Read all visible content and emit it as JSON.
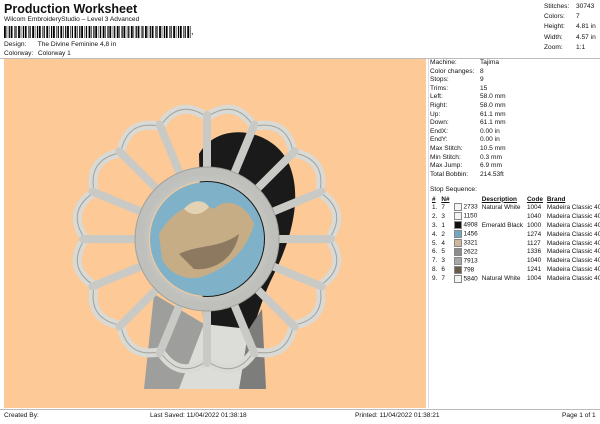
{
  "header": {
    "title": "Production Worksheet",
    "subtitle": "Wilcom EmbroideryStudio – Level 3 Advanced",
    "barcode_mark": ","
  },
  "meta": {
    "design_label": "Design:",
    "design_value": "The Divine Feminine 4,8 in",
    "colorway_label": "Colorway:",
    "colorway_value": "Colorway 1"
  },
  "stats": [
    {
      "label": "Stitches:",
      "value": "30743"
    },
    {
      "label": "Colors:",
      "value": "7"
    },
    {
      "label": "Height:",
      "value": "4.81 in"
    },
    {
      "label": "Width:",
      "value": "4.57 in"
    },
    {
      "label": "Zoom:",
      "value": "1:1"
    }
  ],
  "params": [
    {
      "label": "Machine:",
      "value": "Tajima"
    },
    {
      "label": "Color changes:",
      "value": "8"
    },
    {
      "label": "Stops:",
      "value": "9"
    },
    {
      "label": "Trims:",
      "value": "15"
    },
    {
      "label": "Left:",
      "value": "58.0 mm"
    },
    {
      "label": "Right:",
      "value": "58.0 mm"
    },
    {
      "label": "Up:",
      "value": "61.1 mm"
    },
    {
      "label": "Down:",
      "value": "61.1 mm"
    },
    {
      "label": "EndX:",
      "value": "0.00 in"
    },
    {
      "label": "EndY:",
      "value": "0.00 in"
    },
    {
      "label": "Max Stitch:",
      "value": "10.5 mm"
    },
    {
      "label": "Min Stitch:",
      "value": "0.3 mm"
    },
    {
      "label": "Max Jump:",
      "value": "6.9 mm"
    },
    {
      "label": "Total Bobbin:",
      "value": "214.53ft"
    }
  ],
  "sequence": {
    "title": "Stop Sequence:",
    "headers": [
      "#",
      "N#",
      "",
      "Description",
      "Code",
      "Brand"
    ],
    "rows": [
      {
        "n": "1.",
        "thread": "7",
        "color": "#f4f4f2",
        "num": "2733",
        "desc": "Natural White",
        "code": "1004",
        "brand": "Madeira Classic 40"
      },
      {
        "n": "2.",
        "thread": "3",
        "color": "#f4f4f2",
        "num": "1150",
        "desc": "",
        "code": "1040",
        "brand": "Madeira Classic 40"
      },
      {
        "n": "3.",
        "thread": "1",
        "color": "#111111",
        "num": "4908",
        "desc": "Emerald Black",
        "code": "1000",
        "brand": "Madeira Classic 40"
      },
      {
        "n": "4.",
        "thread": "2",
        "color": "#6fa7c2",
        "num": "1456",
        "desc": "",
        "code": "1274",
        "brand": "Madeira Classic 40"
      },
      {
        "n": "5.",
        "thread": "4",
        "color": "#cdb89b",
        "num": "3321",
        "desc": "",
        "code": "1127",
        "brand": "Madeira Classic 40"
      },
      {
        "n": "6.",
        "thread": "5",
        "color": "#8d8d8d",
        "num": "2622",
        "desc": "",
        "code": "1336",
        "brand": "Madeira Classic 40"
      },
      {
        "n": "7.",
        "thread": "3",
        "color": "#a7a7a7",
        "num": "7913",
        "desc": "",
        "code": "1040",
        "brand": "Madeira Classic 40"
      },
      {
        "n": "8.",
        "thread": "6",
        "color": "#6a5a4a",
        "num": "798",
        "desc": "",
        "code": "1241",
        "brand": "Madeira Classic 40"
      },
      {
        "n": "9.",
        "thread": "7",
        "color": "#f4f4f2",
        "num": "5840",
        "desc": "Natural White",
        "code": "1004",
        "brand": "Madeira Classic 40"
      }
    ]
  },
  "footer": {
    "created": "Created By:",
    "saved": "Last Saved: 11/04/2022 01:38:18",
    "printed": "Printed: 11/04/2022 01:38:21",
    "page": "Page 1 of 1"
  },
  "colors": {
    "design_background": "#fcc997",
    "frame": "#d9dad6",
    "center_blue": "#7fb2c8",
    "hair": "#1a1a1a"
  }
}
